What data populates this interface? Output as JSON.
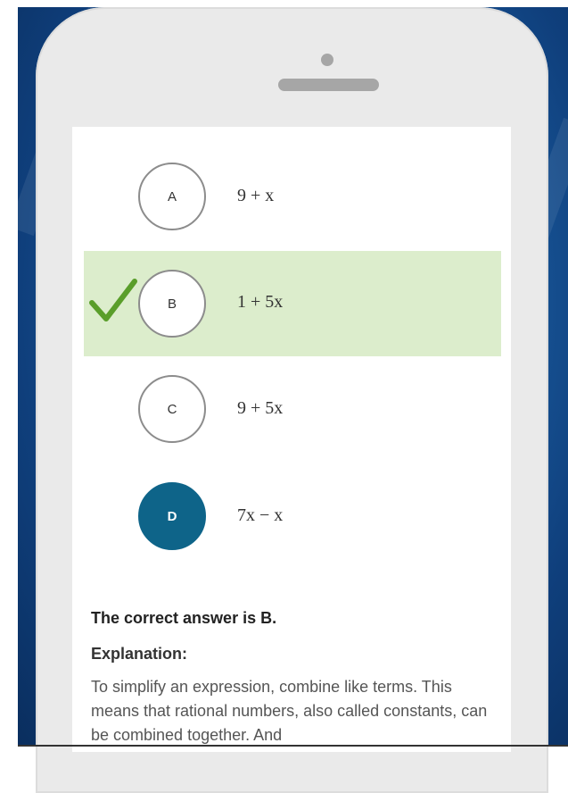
{
  "quiz": {
    "options": [
      {
        "letter": "A",
        "expression": "9 + x"
      },
      {
        "letter": "B",
        "expression": "1 + 5x"
      },
      {
        "letter": "C",
        "expression": "9 + 5x"
      },
      {
        "letter": "D",
        "expression": "7x − x"
      }
    ],
    "correct_letter": "B",
    "selected_letter": "D",
    "correct_answer_text": "The correct answer is B.",
    "explanation_label": "Explanation:",
    "explanation_text": "To simplify an expression, combine like terms. This means that rational numbers, also called constants, can be combined together. And"
  },
  "colors": {
    "correct_highlight": "#dcedcc",
    "check_mark": "#5a9e2a",
    "selected_circle": "#0e6489",
    "phone_body": "#eaeaea",
    "background": "#1c5fa3"
  },
  "icons": {
    "correct_indicator": "check-mark-icon"
  }
}
